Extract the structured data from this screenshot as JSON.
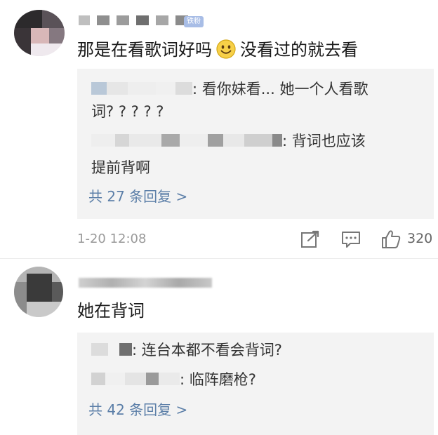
{
  "comment1": {
    "badge": "铁粉",
    "text_before": "那是在看歌词好吗",
    "emoji": "smile-emoji",
    "text_after": "没看过的就去看",
    "replies": [
      {
        "line1": ": 看你妹看... 她一个人看歌",
        "line2": "词? ? ? ? ?"
      },
      {
        "line1": ": 背词也应该",
        "line2": "提前背啊"
      }
    ],
    "more_replies": "共 27 条回复 >",
    "time": "1-20 12:08",
    "likes": "320"
  },
  "comment2": {
    "text": "她在背词",
    "replies": [
      {
        "line1": ": 连台本都不看会背词?"
      },
      {
        "line1": ": 临阵磨枪?"
      }
    ],
    "more_replies": "共 42 条回复 >"
  },
  "colors": {
    "link": "#5c7fa8",
    "badge": "#a8bde6",
    "reply_bg": "#f3f3f3"
  }
}
